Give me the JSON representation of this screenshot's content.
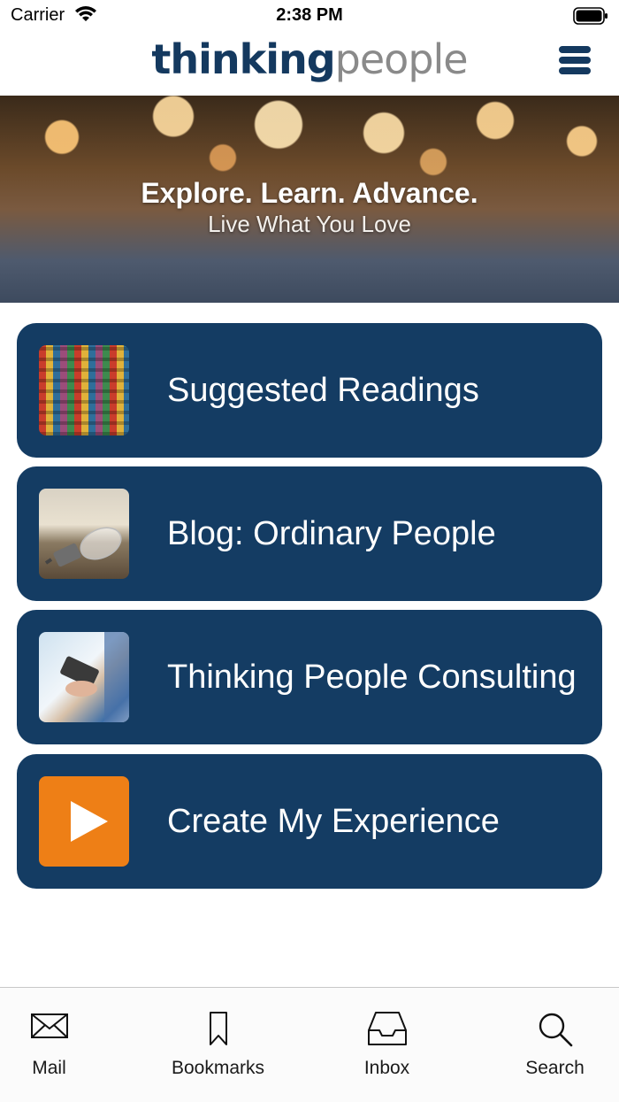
{
  "status_bar": {
    "carrier": "Carrier",
    "time": "2:38 PM"
  },
  "header": {
    "logo_part1": "thinking",
    "logo_part2": "people",
    "menu_icon": "hamburger-menu-icon"
  },
  "hero": {
    "title": "Explore. Learn. Advance.",
    "subtitle": "Live What You Love"
  },
  "menu_items": [
    {
      "label": "Suggested Readings",
      "icon": "books-thumbnail"
    },
    {
      "label": "Blog: Ordinary People",
      "icon": "lightbulb-thumbnail"
    },
    {
      "label": "Thinking People Consulting",
      "icon": "phone-thumbnail"
    },
    {
      "label": "Create My Experience",
      "icon": "play-icon"
    }
  ],
  "tabbar": {
    "tabs": [
      {
        "label": "Mail",
        "icon": "mail-icon"
      },
      {
        "label": "Bookmarks",
        "icon": "bookmark-icon"
      },
      {
        "label": "Inbox",
        "icon": "inbox-icon"
      },
      {
        "label": "Search",
        "icon": "search-icon"
      }
    ]
  },
  "colors": {
    "brand_navy": "#143c63",
    "accent_orange": "#ee7f16",
    "logo_gray": "#8a8a8a"
  }
}
